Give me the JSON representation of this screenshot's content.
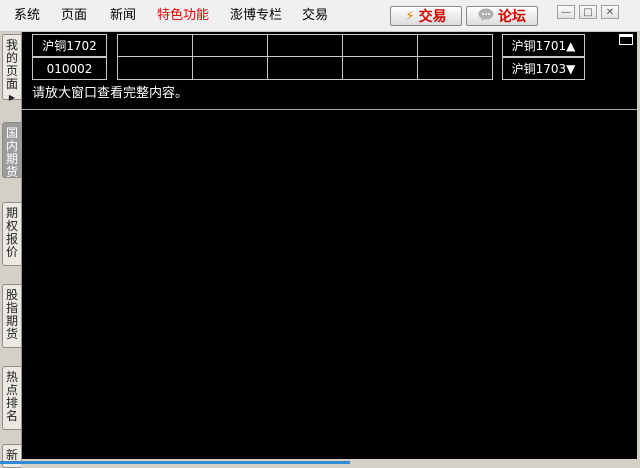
{
  "menu": {
    "items": [
      "系统",
      "页面",
      "新闻",
      "特色功能",
      "澎博专栏",
      "交易"
    ],
    "special_index": 3
  },
  "top_buttons": {
    "trade": {
      "icon": "lightning-icon",
      "label": "交易"
    },
    "forum": {
      "icon": "speech-bubble-icon",
      "label": "论坛"
    }
  },
  "window_controls": {
    "minimize": "—",
    "maximize": "□",
    "close": "✕"
  },
  "side_tabs": [
    {
      "label": "我的页面",
      "active": false,
      "has_arrow": true
    },
    {
      "label": "国内期货",
      "active": true,
      "has_arrow": false
    },
    {
      "label": "期权报价",
      "active": false,
      "has_arrow": false
    },
    {
      "label": "股指期货",
      "active": false,
      "has_arrow": false
    },
    {
      "label": "热点排名",
      "active": false,
      "has_arrow": false
    },
    {
      "label": "新",
      "active": false,
      "has_arrow": false
    }
  ],
  "quote_panel": {
    "instrument": "沪铜1702",
    "code": "010002",
    "prev_contract": "沪铜1701▲",
    "next_contract": "沪铜1703▼",
    "notice": "请放大窗口查看完整内容。"
  },
  "colors": {
    "panel_bg": "#000000",
    "special_menu": "#e00000",
    "active_tab": "#9c9c9c"
  }
}
